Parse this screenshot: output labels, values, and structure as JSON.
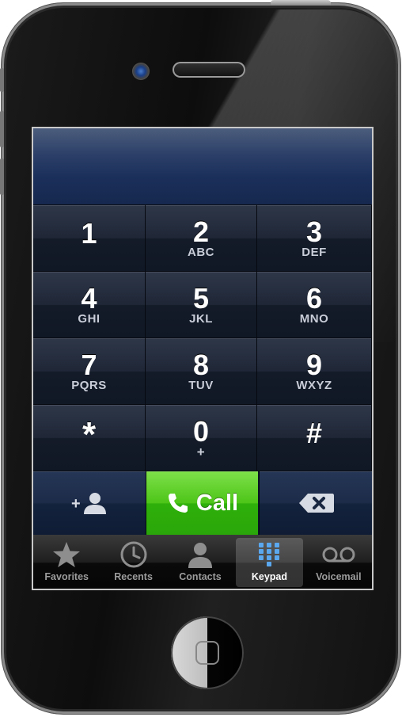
{
  "keypad": {
    "keys": [
      {
        "digit": "1",
        "letters": ""
      },
      {
        "digit": "2",
        "letters": "ABC"
      },
      {
        "digit": "3",
        "letters": "DEF"
      },
      {
        "digit": "4",
        "letters": "GHI"
      },
      {
        "digit": "5",
        "letters": "JKL"
      },
      {
        "digit": "6",
        "letters": "MNO"
      },
      {
        "digit": "7",
        "letters": "PQRS"
      },
      {
        "digit": "8",
        "letters": "TUV"
      },
      {
        "digit": "9",
        "letters": "WXYZ"
      },
      {
        "digit": "*",
        "letters": ""
      },
      {
        "digit": "0",
        "letters": "+"
      },
      {
        "digit": "#",
        "letters": ""
      }
    ]
  },
  "actions": {
    "add_contact_icon": "add-contact-icon",
    "call_label": "Call",
    "call_icon": "phone-handset-icon",
    "delete_icon": "backspace-icon",
    "call_color": "#4dc518"
  },
  "tabbar": {
    "tabs": [
      {
        "label": "Favorites",
        "icon": "star-icon",
        "active": false
      },
      {
        "label": "Recents",
        "icon": "clock-icon",
        "active": false
      },
      {
        "label": "Contacts",
        "icon": "person-icon",
        "active": false
      },
      {
        "label": "Keypad",
        "icon": "keypad-grid-icon",
        "active": true
      },
      {
        "label": "Voicemail",
        "icon": "voicemail-icon",
        "active": false
      }
    ]
  }
}
